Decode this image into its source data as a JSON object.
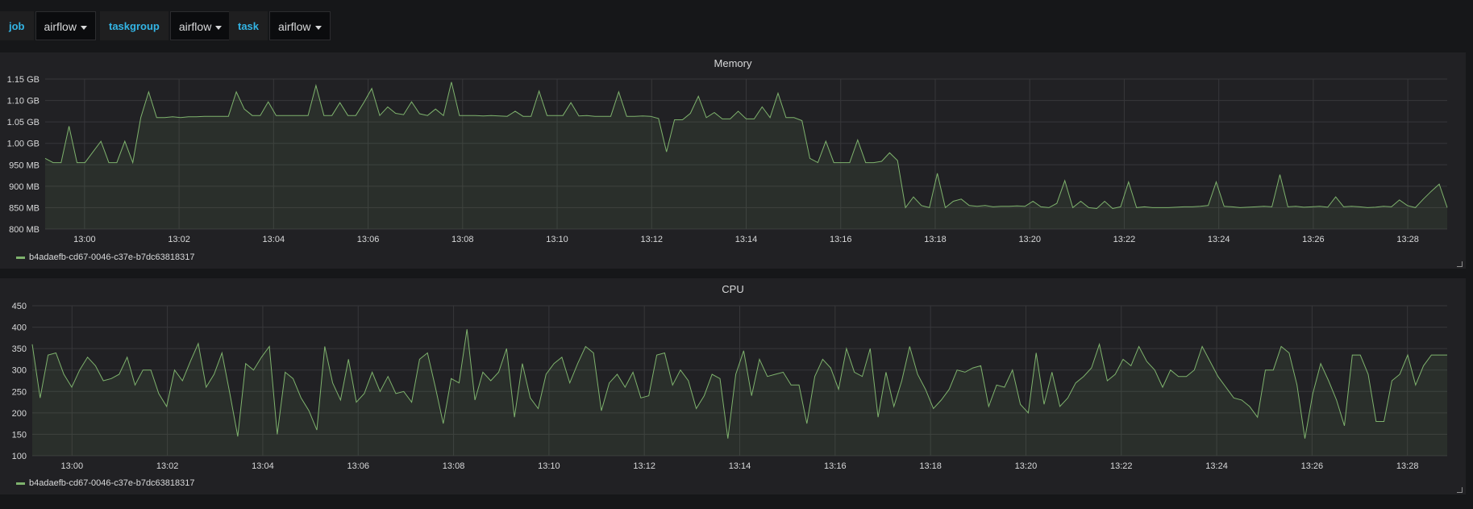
{
  "variables": [
    {
      "label": "job",
      "value": "airflow"
    },
    {
      "label": "taskgroup",
      "value": "airflow"
    },
    {
      "label": "task",
      "value": "airflow"
    }
  ],
  "colors": {
    "series": "#7eb26d",
    "label": "#33b5e5",
    "panel_bg": "#212124",
    "page_bg": "#161719",
    "grid": "#37373a"
  },
  "panels": [
    {
      "title": "Memory",
      "legend": "b4adaefb-cd67-0046-c37e-b7dc63818317",
      "chart_data": {
        "type": "area",
        "title": "Memory",
        "x_range": [
          "12:59:10",
          "13:28:50"
        ],
        "x_ticks": [
          "13:00",
          "13:02",
          "13:04",
          "13:06",
          "13:08",
          "13:10",
          "13:12",
          "13:14",
          "13:16",
          "13:18",
          "13:20",
          "13:22",
          "13:24",
          "13:26",
          "13:28"
        ],
        "y_ticks": [
          "800 MB",
          "850 MB",
          "900 MB",
          "950 MB",
          "1.00 GB",
          "1.05 GB",
          "1.10 GB",
          "1.15 GB"
        ],
        "ylim_mb": [
          800,
          1150
        ],
        "series": [
          {
            "name": "b4adaefb-cd67-0046-c37e-b7dc63818317",
            "unit": "MB",
            "values": [
              965,
              955,
              955,
              1040,
              955,
              955,
              980,
              1005,
              955,
              955,
              1005,
              955,
              1060,
              1120,
              1060,
              1060,
              1062,
              1060,
              1062,
              1062,
              1063,
              1063,
              1063,
              1063,
              1120,
              1080,
              1065,
              1065,
              1097,
              1065,
              1065,
              1065,
              1065,
              1065,
              1135,
              1065,
              1065,
              1095,
              1065,
              1065,
              1095,
              1128,
              1065,
              1085,
              1070,
              1067,
              1097,
              1069,
              1065,
              1080,
              1065,
              1143,
              1065,
              1065,
              1065,
              1064,
              1065,
              1064,
              1063,
              1075,
              1063,
              1063,
              1122,
              1065,
              1065,
              1065,
              1095,
              1064,
              1065,
              1063,
              1063,
              1063,
              1120,
              1063,
              1063,
              1064,
              1063,
              1058,
              980,
              1055,
              1055,
              1070,
              1110,
              1060,
              1072,
              1057,
              1057,
              1075,
              1057,
              1057,
              1085,
              1060,
              1117,
              1060,
              1060,
              1053,
              965,
              955,
              1005,
              955,
              955,
              955,
              1008,
              955,
              955,
              958,
              978,
              960,
              850,
              875,
              855,
              850,
              930,
              850,
              865,
              870,
              855,
              853,
              855,
              852,
              853,
              853,
              854,
              853,
              865,
              852,
              850,
              860,
              913,
              850,
              865,
              850,
              848,
              865,
              848,
              852,
              910,
              850,
              852,
              850,
              850,
              850,
              851,
              852,
              852,
              853,
              855,
              910,
              853,
              852,
              850,
              851,
              852,
              853,
              852,
              927,
              852,
              853,
              851,
              852,
              853,
              851,
              875,
              852,
              853,
              852,
              850,
              851,
              853,
              852,
              868,
              855,
              850,
              870,
              888,
              905,
              850
            ]
          }
        ]
      }
    },
    {
      "title": "CPU",
      "legend": "b4adaefb-cd67-0046-c37e-b7dc63818317",
      "chart_data": {
        "type": "area",
        "title": "CPU",
        "x_range": [
          "12:59:10",
          "13:28:50"
        ],
        "x_ticks": [
          "13:00",
          "13:02",
          "13:04",
          "13:06",
          "13:08",
          "13:10",
          "13:12",
          "13:14",
          "13:16",
          "13:18",
          "13:20",
          "13:22",
          "13:24",
          "13:26",
          "13:28"
        ],
        "y_ticks": [
          "100",
          "150",
          "200",
          "250",
          "300",
          "350",
          "400",
          "450"
        ],
        "ylim": [
          100,
          450
        ],
        "series": [
          {
            "name": "b4adaefb-cd67-0046-c37e-b7dc63818317",
            "values": [
              360,
              235,
              335,
              340,
              290,
              260,
              300,
              330,
              310,
              275,
              280,
              290,
              330,
              265,
              300,
              300,
              245,
              215,
              300,
              275,
              320,
              362,
              260,
              290,
              340,
              245,
              145,
              315,
              300,
              330,
              355,
              150,
              295,
              280,
              235,
              205,
              160,
              355,
              270,
              230,
              325,
              225,
              245,
              295,
              250,
              285,
              245,
              250,
              225,
              325,
              340,
              260,
              175,
              280,
              270,
              395,
              230,
              295,
              275,
              295,
              350,
              190,
              315,
              235,
              210,
              290,
              315,
              330,
              270,
              315,
              355,
              340,
              205,
              270,
              290,
              260,
              295,
              235,
              240,
              335,
              340,
              265,
              300,
              275,
              210,
              240,
              290,
              280,
              140,
              290,
              345,
              240,
              325,
              285,
              290,
              295,
              265,
              265,
              175,
              285,
              325,
              305,
              255,
              350,
              295,
              285,
              350,
              190,
              295,
              215,
              275,
              355,
              290,
              255,
              210,
              230,
              255,
              300,
              295,
              305,
              310,
              215,
              265,
              260,
              300,
              220,
              200,
              340,
              220,
              295,
              215,
              235,
              270,
              285,
              305,
              360,
              275,
              290,
              325,
              310,
              355,
              320,
              300,
              260,
              300,
              285,
              285,
              300,
              355,
              320,
              285,
              260,
              235,
              230,
              215,
              190,
              300,
              300,
              355,
              340,
              265,
              140,
              245,
              315,
              275,
              230,
              170,
              335,
              335,
              290,
              180,
              180,
              275,
              290,
              335,
              265,
              310,
              335,
              335,
              335
            ]
          }
        ]
      }
    }
  ]
}
